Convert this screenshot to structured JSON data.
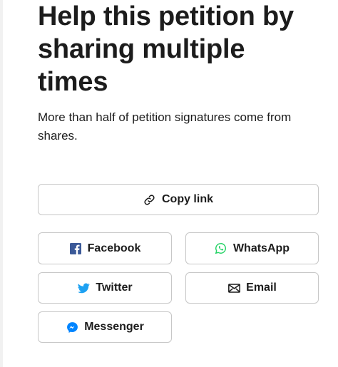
{
  "heading": {
    "line1": "Help this petition by",
    "line2": "sharing multiple",
    "line3": "times"
  },
  "subtext": "More than half of petition signatures come from shares.",
  "buttons": {
    "copy_link": "Copy link",
    "facebook": "Facebook",
    "whatsapp": "WhatsApp",
    "twitter": "Twitter",
    "email": "Email",
    "messenger": "Messenger"
  },
  "icons": {
    "copy_link": "link-icon",
    "facebook": "facebook-icon",
    "whatsapp": "whatsapp-icon",
    "twitter": "twitter-icon",
    "email": "email-icon",
    "messenger": "messenger-icon"
  },
  "colors": {
    "facebook": "#3b5998",
    "whatsapp": "#25d366",
    "twitter": "#1da1f2",
    "messenger": "#0084ff",
    "text": "#1c1c1c",
    "border": "#c7c7c7"
  }
}
